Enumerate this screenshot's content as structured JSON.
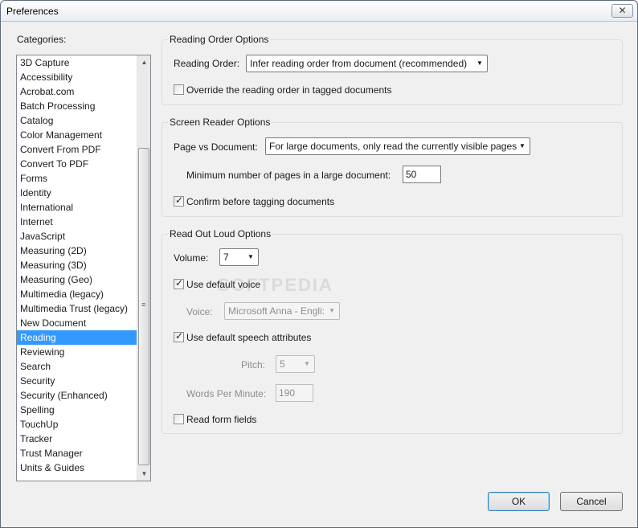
{
  "window": {
    "title": "Preferences",
    "close_glyph": "✕"
  },
  "categories": {
    "label": "Categories:",
    "items": [
      "3D Capture",
      "Accessibility",
      "Acrobat.com",
      "Batch Processing",
      "Catalog",
      "Color Management",
      "Convert From PDF",
      "Convert To PDF",
      "Forms",
      "Identity",
      "International",
      "Internet",
      "JavaScript",
      "Measuring (2D)",
      "Measuring (3D)",
      "Measuring (Geo)",
      "Multimedia (legacy)",
      "Multimedia Trust (legacy)",
      "New Document",
      "Reading",
      "Reviewing",
      "Search",
      "Security",
      "Security (Enhanced)",
      "Spelling",
      "TouchUp",
      "Tracker",
      "Trust Manager",
      "Units & Guides"
    ],
    "selected": "Reading"
  },
  "reading_order": {
    "group_title": "Reading Order Options",
    "label": "Reading Order:",
    "value": "Infer reading order from document (recommended)",
    "override_label": "Override the reading order in tagged documents",
    "override_checked": false
  },
  "screen_reader": {
    "group_title": "Screen Reader Options",
    "page_vs_doc_label": "Page vs Document:",
    "page_vs_doc_value": "For large documents, only read the currently visible pages",
    "min_pages_label": "Minimum number of pages in a large document:",
    "min_pages_value": "50",
    "confirm_label": "Confirm before tagging documents",
    "confirm_checked": true
  },
  "read_out_loud": {
    "group_title": "Read Out Loud Options",
    "volume_label": "Volume:",
    "volume_value": "7",
    "default_voice_label": "Use default voice",
    "default_voice_checked": true,
    "voice_label": "Voice:",
    "voice_value": "Microsoft Anna - Engli:",
    "default_speech_label": "Use default speech attributes",
    "default_speech_checked": true,
    "pitch_label": "Pitch:",
    "pitch_value": "5",
    "wpm_label": "Words Per Minute:",
    "wpm_value": "190",
    "read_form_label": "Read form fields",
    "read_form_checked": false
  },
  "watermark": "SOFTPEDIA",
  "buttons": {
    "ok": "OK",
    "cancel": "Cancel"
  }
}
